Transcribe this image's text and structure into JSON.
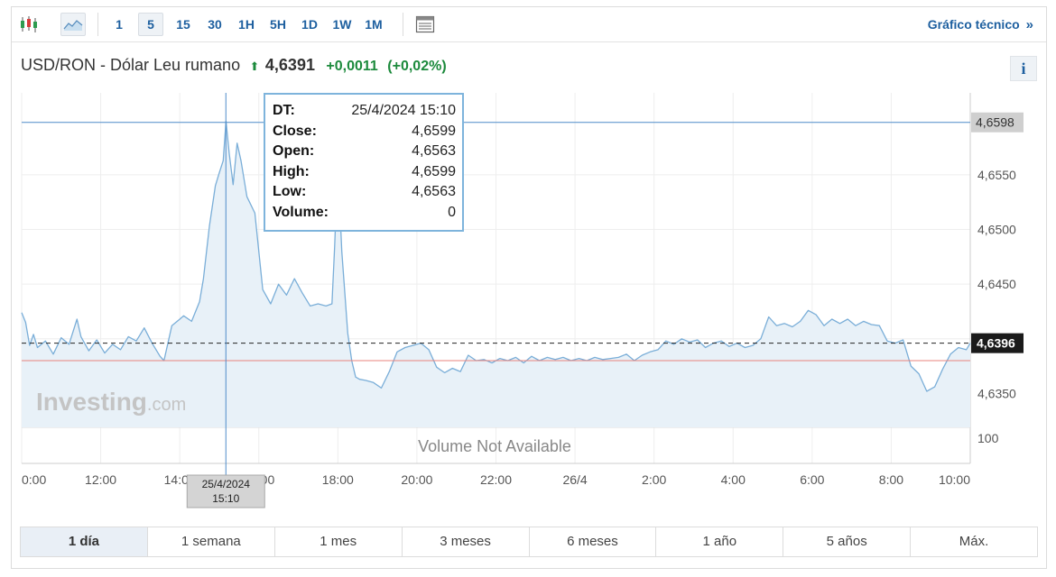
{
  "toolbar": {
    "timeframes": [
      "1",
      "5",
      "15",
      "30",
      "1H",
      "5H",
      "1D",
      "1W",
      "1M"
    ],
    "active_timeframe": "5",
    "tech_link": "Gráfico técnico",
    "icons": [
      "candlestick-icon",
      "area-chart-icon",
      "layout-icon"
    ]
  },
  "header": {
    "instrument": "USD/RON - Dólar Leu rumano",
    "price": "4,6391",
    "change": "+0,0011",
    "change_pct": "(+0,02%)",
    "info_label": "i"
  },
  "colors": {
    "accent_blue": "#1d5f9f",
    "positive_green": "#1c8a3c",
    "line": "#7aaed8",
    "area_fill": "#e8f1f8",
    "prev_close_line": "#e8837c"
  },
  "tooltip": {
    "rows": [
      {
        "label": "DT:",
        "value": "25/4/2024 15:10"
      },
      {
        "label": "Close:",
        "value": "4,6599"
      },
      {
        "label": "Open:",
        "value": "4,6563"
      },
      {
        "label": "High:",
        "value": "4,6599"
      },
      {
        "label": "Low:",
        "value": "4,6563"
      },
      {
        "label": "Volume:",
        "value": "0"
      }
    ]
  },
  "ranges": [
    "1 día",
    "1 semana",
    "1 mes",
    "3 meses",
    "6 meses",
    "1 año",
    "5 años",
    "Máx."
  ],
  "active_range": "1 día",
  "chart_data": {
    "type": "area",
    "x_unit": "hours since 25/4 00:00",
    "x_ticks": [
      {
        "x": 10,
        "label": "0:00"
      },
      {
        "x": 12,
        "label": "12:00"
      },
      {
        "x": 14,
        "label": "14:00"
      },
      {
        "x": 16,
        "label": "16:00"
      },
      {
        "x": 18,
        "label": "18:00"
      },
      {
        "x": 20,
        "label": "20:00"
      },
      {
        "x": 22,
        "label": "22:00"
      },
      {
        "x": 24,
        "label": "26/4"
      },
      {
        "x": 26,
        "label": "2:00"
      },
      {
        "x": 28,
        "label": "4:00"
      },
      {
        "x": 30,
        "label": "6:00"
      },
      {
        "x": 32,
        "label": "8:00"
      },
      {
        "x": 34,
        "label": "10:00"
      }
    ],
    "xlim": [
      10,
      34
    ],
    "y_ticks": [
      {
        "value": 4.635,
        "label": "4,6350"
      },
      {
        "value": 4.64,
        "label": "4,6400"
      },
      {
        "value": 4.645,
        "label": "4,6450"
      },
      {
        "value": 4.65,
        "label": "4,6500"
      },
      {
        "value": 4.655,
        "label": "4,6550"
      }
    ],
    "ylim": [
      4.6319,
      4.6625
    ],
    "current_value": {
      "value": 4.6396,
      "label": "4,6396"
    },
    "crosshair_value": {
      "value": 4.6598,
      "label": "4,6598"
    },
    "crosshair_x": {
      "x": 15.1667,
      "label": "25/4/2024\n15:10"
    },
    "prev_close": 4.638,
    "watermark_main": "Investing",
    "watermark_suffix": ".com",
    "volume_text": "Volume Not Available",
    "volume_axis_label": "100",
    "series": [
      {
        "x": [
          10.0,
          10.1,
          10.2,
          10.3,
          10.4,
          10.6,
          10.8,
          11.0,
          11.2,
          11.4,
          11.5,
          11.7,
          11.9,
          12.1,
          12.3,
          12.5,
          12.7,
          12.9,
          13.1,
          13.3,
          13.5,
          13.6,
          13.8,
          14.0,
          14.1,
          14.3,
          14.5,
          14.6,
          14.75,
          14.9,
          15.0,
          15.1,
          15.17,
          15.25,
          15.35,
          15.45,
          15.55,
          15.7,
          15.9,
          16.1,
          16.3,
          16.5,
          16.7,
          16.9,
          17.1,
          17.3,
          17.5,
          17.7,
          17.85,
          17.92,
          18.0,
          18.1,
          18.25,
          18.35,
          18.45,
          18.55,
          18.7,
          18.9,
          19.1,
          19.3,
          19.5,
          19.7,
          19.9,
          20.1,
          20.3,
          20.5,
          20.7,
          20.9,
          21.1,
          21.3,
          21.5,
          21.7,
          21.9,
          22.1,
          22.3,
          22.5,
          22.7,
          22.9,
          23.1,
          23.3,
          23.5,
          23.7,
          23.9,
          24.1,
          24.3,
          24.5,
          24.7,
          24.9,
          25.1,
          25.3,
          25.5,
          25.7,
          25.9,
          26.1,
          26.3,
          26.5,
          26.7,
          26.9,
          27.1,
          27.3,
          27.5,
          27.7,
          27.9,
          28.1,
          28.3,
          28.5,
          28.7,
          28.9,
          29.1,
          29.3,
          29.5,
          29.7,
          29.9,
          30.1,
          30.3,
          30.5,
          30.7,
          30.9,
          31.1,
          31.3,
          31.5,
          31.7,
          31.9,
          32.1,
          32.3,
          32.5,
          32.7,
          32.9,
          33.1,
          33.3,
          33.5,
          33.7,
          33.9,
          34.0
        ],
        "y": [
          4.6424,
          4.6415,
          4.6394,
          4.6404,
          4.6392,
          4.6398,
          4.6386,
          4.6401,
          4.6395,
          4.6418,
          4.6402,
          4.6389,
          4.6399,
          4.6387,
          4.6395,
          4.639,
          4.6402,
          4.6398,
          4.641,
          4.6396,
          4.6384,
          4.638,
          4.6412,
          4.6418,
          4.6421,
          4.6416,
          4.6434,
          4.6455,
          4.6503,
          4.654,
          4.6552,
          4.6563,
          4.6599,
          4.657,
          4.6541,
          4.6579,
          4.6563,
          4.653,
          4.6515,
          4.6445,
          4.6432,
          4.645,
          4.644,
          4.6455,
          4.6442,
          4.643,
          4.6432,
          4.643,
          4.6432,
          4.6485,
          4.656,
          4.648,
          4.6405,
          4.638,
          4.6365,
          4.6363,
          4.6362,
          4.636,
          4.6355,
          4.637,
          4.6388,
          4.6392,
          4.6394,
          4.6396,
          4.639,
          4.6374,
          4.6369,
          4.6373,
          4.637,
          4.6385,
          4.638,
          4.6381,
          4.6378,
          4.6382,
          4.638,
          4.6383,
          4.6378,
          4.6384,
          4.638,
          4.6383,
          4.6381,
          4.6383,
          4.638,
          4.6382,
          4.638,
          4.6383,
          4.6381,
          4.6382,
          4.6383,
          4.6386,
          4.638,
          4.6385,
          4.6388,
          4.639,
          4.6398,
          4.6395,
          4.64,
          4.6397,
          4.6399,
          4.6392,
          4.6396,
          4.6398,
          4.6393,
          4.6396,
          4.6392,
          4.6394,
          4.64,
          4.642,
          4.6412,
          4.6414,
          4.6411,
          4.6416,
          4.6426,
          4.6422,
          4.6412,
          4.6418,
          4.6414,
          4.6418,
          4.6412,
          4.6416,
          4.6413,
          4.6412,
          4.6398,
          4.6396,
          4.6399,
          4.6375,
          4.6368,
          4.6352,
          4.6356,
          4.6372,
          4.6386,
          4.6392,
          4.639,
          4.6396
        ]
      }
    ]
  }
}
